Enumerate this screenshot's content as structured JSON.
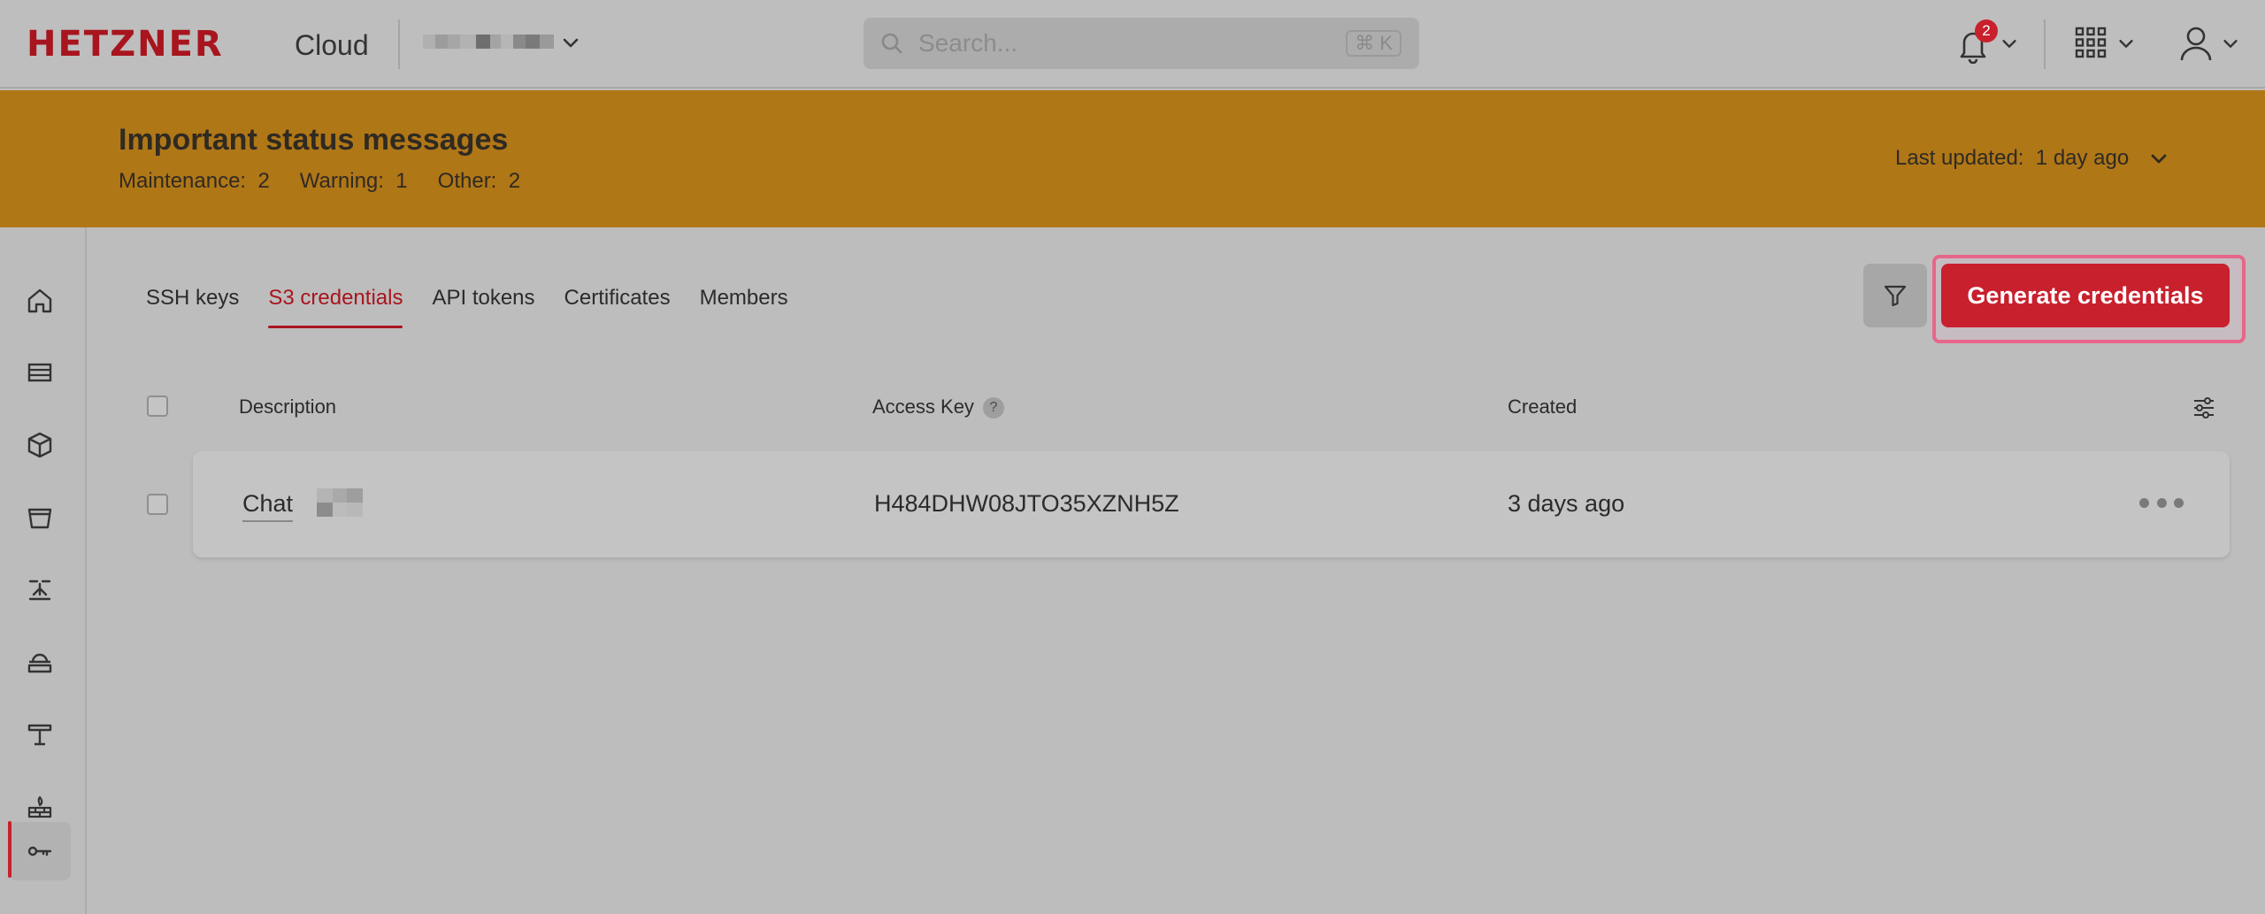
{
  "topbar": {
    "brand": "HETZNER",
    "product": "Cloud",
    "search_placeholder": "Search...",
    "search_shortcut": "⌘ K",
    "notifications_count": "2",
    "icons": [
      "chevron-down-icon",
      "search-icon",
      "bell-icon",
      "apps-grid-icon",
      "user-icon"
    ]
  },
  "banner": {
    "title": "Important status messages",
    "maintenance_label": "Maintenance:",
    "maintenance_count": "2",
    "warning_label": "Warning:",
    "warning_count": "1",
    "other_label": "Other:",
    "other_count": "2",
    "updated_label": "Last updated:",
    "updated_value": "1 day ago"
  },
  "sidebar": {
    "items": [
      {
        "icon": "home-icon"
      },
      {
        "icon": "servers-icon"
      },
      {
        "icon": "cube-icon"
      },
      {
        "icon": "bucket-icon"
      },
      {
        "icon": "network-icon"
      },
      {
        "icon": "cloud-storage-icon"
      },
      {
        "icon": "load-balancer-icon"
      },
      {
        "icon": "firewall-icon"
      },
      {
        "icon": "key-icon",
        "active": true
      }
    ]
  },
  "tabs": [
    {
      "label": "SSH keys"
    },
    {
      "label": "S3 credentials",
      "active": true
    },
    {
      "label": "API tokens"
    },
    {
      "label": "Certificates"
    },
    {
      "label": "Members"
    }
  ],
  "actions": {
    "generate_label": "Generate credentials"
  },
  "table": {
    "headers": {
      "description": "Description",
      "access_key": "Access Key",
      "access_key_help": "?",
      "created": "Created"
    },
    "rows": [
      {
        "description": "Chat",
        "access_key": "H484DHW08JTO35XZNH5Z",
        "created": "3 days ago"
      }
    ]
  },
  "colors": {
    "brand_red": "#c8202d",
    "banner_orange": "#b07717",
    "highlight_pink": "#e7668a"
  }
}
